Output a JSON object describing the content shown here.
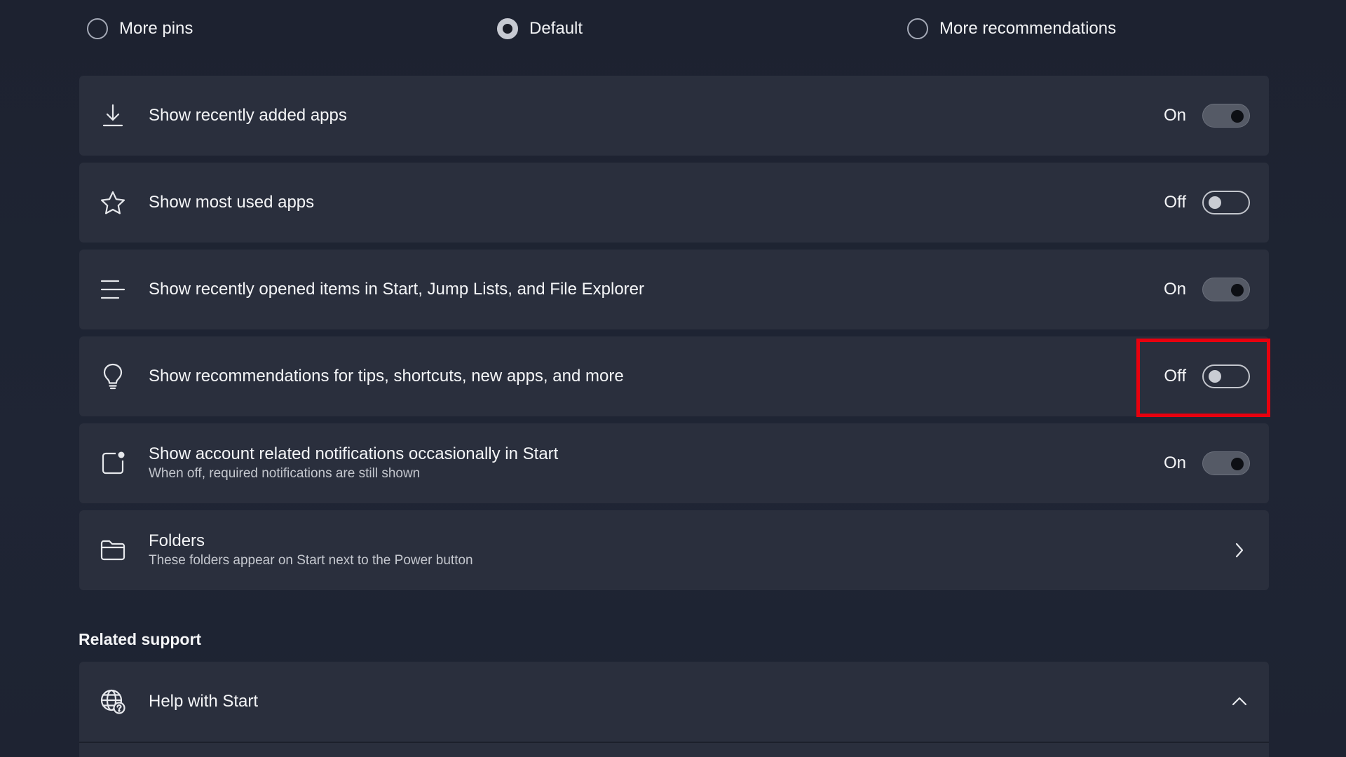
{
  "layout_options": [
    {
      "label": "More pins",
      "selected": false
    },
    {
      "label": "Default",
      "selected": true
    },
    {
      "label": "More recommendations",
      "selected": false
    }
  ],
  "settings": [
    {
      "icon": "download-icon",
      "title": "Show recently added apps",
      "subtitle": "",
      "state": "On",
      "on": true
    },
    {
      "icon": "star-icon",
      "title": "Show most used apps",
      "subtitle": "",
      "state": "Off",
      "on": false
    },
    {
      "icon": "list-icon",
      "title": "Show recently opened items in Start, Jump Lists, and File Explorer",
      "subtitle": "",
      "state": "On",
      "on": true
    },
    {
      "icon": "lightbulb-icon",
      "title": "Show recommendations for tips, shortcuts, new apps, and more",
      "subtitle": "",
      "state": "Off",
      "on": false
    },
    {
      "icon": "notification-badge-icon",
      "title": "Show account related notifications occasionally in Start",
      "subtitle": "When off, required notifications are still shown",
      "state": "On",
      "on": true
    },
    {
      "icon": "folder-icon",
      "title": "Folders",
      "subtitle": "These folders appear on Start next to the Power button"
    }
  ],
  "related_support": {
    "title": "Related support",
    "help_title": "Help with Start"
  },
  "colors": {
    "background": "#1e2331",
    "card": "#2a2f3d",
    "highlight": "#e8000e"
  }
}
